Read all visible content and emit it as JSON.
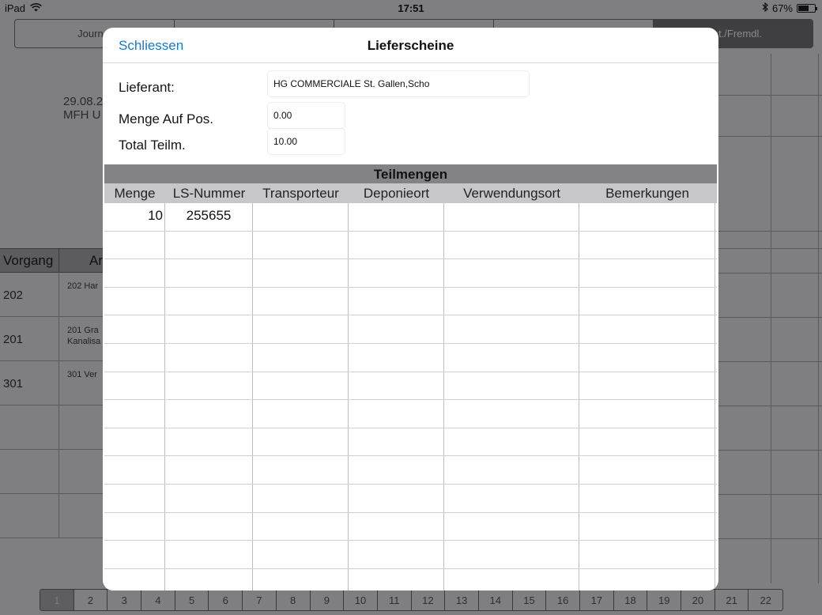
{
  "status_bar": {
    "device": "iPad",
    "time": "17:51",
    "battery": "67%",
    "battery_level": 0.67
  },
  "background": {
    "segments": [
      "Journal",
      "",
      "",
      "",
      "Mat./Fremdl."
    ],
    "date_lines": [
      "29.08.2",
      "MFH U"
    ],
    "table_headers": [
      "Vorgang",
      "Ar"
    ],
    "rows": [
      {
        "vorgang": "202",
        "text": [
          "202 Har"
        ]
      },
      {
        "vorgang": "201",
        "text": [
          "201 Gra",
          "Kanalisa"
        ]
      },
      {
        "vorgang": "301",
        "text": [
          "301 Ver"
        ]
      }
    ],
    "pages": [
      "1",
      "2",
      "3",
      "4",
      "5",
      "6",
      "7",
      "8",
      "9",
      "10",
      "11",
      "12",
      "13",
      "14",
      "15",
      "16",
      "17",
      "18",
      "19",
      "20",
      "21",
      "22"
    ]
  },
  "modal": {
    "close_label": "Schliessen",
    "title": "Lieferscheine",
    "lieferant_label": "Lieferant:",
    "lieferant_value": "HG COMMERCIALE St. Gallen,Scho",
    "menge_label": "Menge Auf Pos.",
    "menge_value": "0.00",
    "total_label": "Total Teilm.",
    "total_value": "10.00",
    "grid_title": "Teilmengen",
    "columns": [
      "Menge",
      "LS-Nummer",
      "Transporteur",
      "Deponieort",
      "Verwendungsort",
      "Bemerkungen"
    ],
    "rows": [
      [
        "10",
        "255655",
        "",
        "",
        "",
        ""
      ],
      [
        "",
        "",
        "",
        "",
        "",
        ""
      ],
      [
        "",
        "",
        "",
        "",
        "",
        ""
      ],
      [
        "",
        "",
        "",
        "",
        "",
        ""
      ],
      [
        "",
        "",
        "",
        "",
        "",
        ""
      ],
      [
        "",
        "",
        "",
        "",
        "",
        ""
      ],
      [
        "",
        "",
        "",
        "",
        "",
        ""
      ],
      [
        "",
        "",
        "",
        "",
        "",
        ""
      ],
      [
        "",
        "",
        "",
        "",
        "",
        ""
      ],
      [
        "",
        "",
        "",
        "",
        "",
        ""
      ],
      [
        "",
        "",
        "",
        "",
        "",
        ""
      ],
      [
        "",
        "",
        "",
        "",
        "",
        ""
      ],
      [
        "",
        "",
        "",
        "",
        "",
        ""
      ],
      [
        "",
        "",
        "",
        "",
        "",
        ""
      ]
    ]
  }
}
